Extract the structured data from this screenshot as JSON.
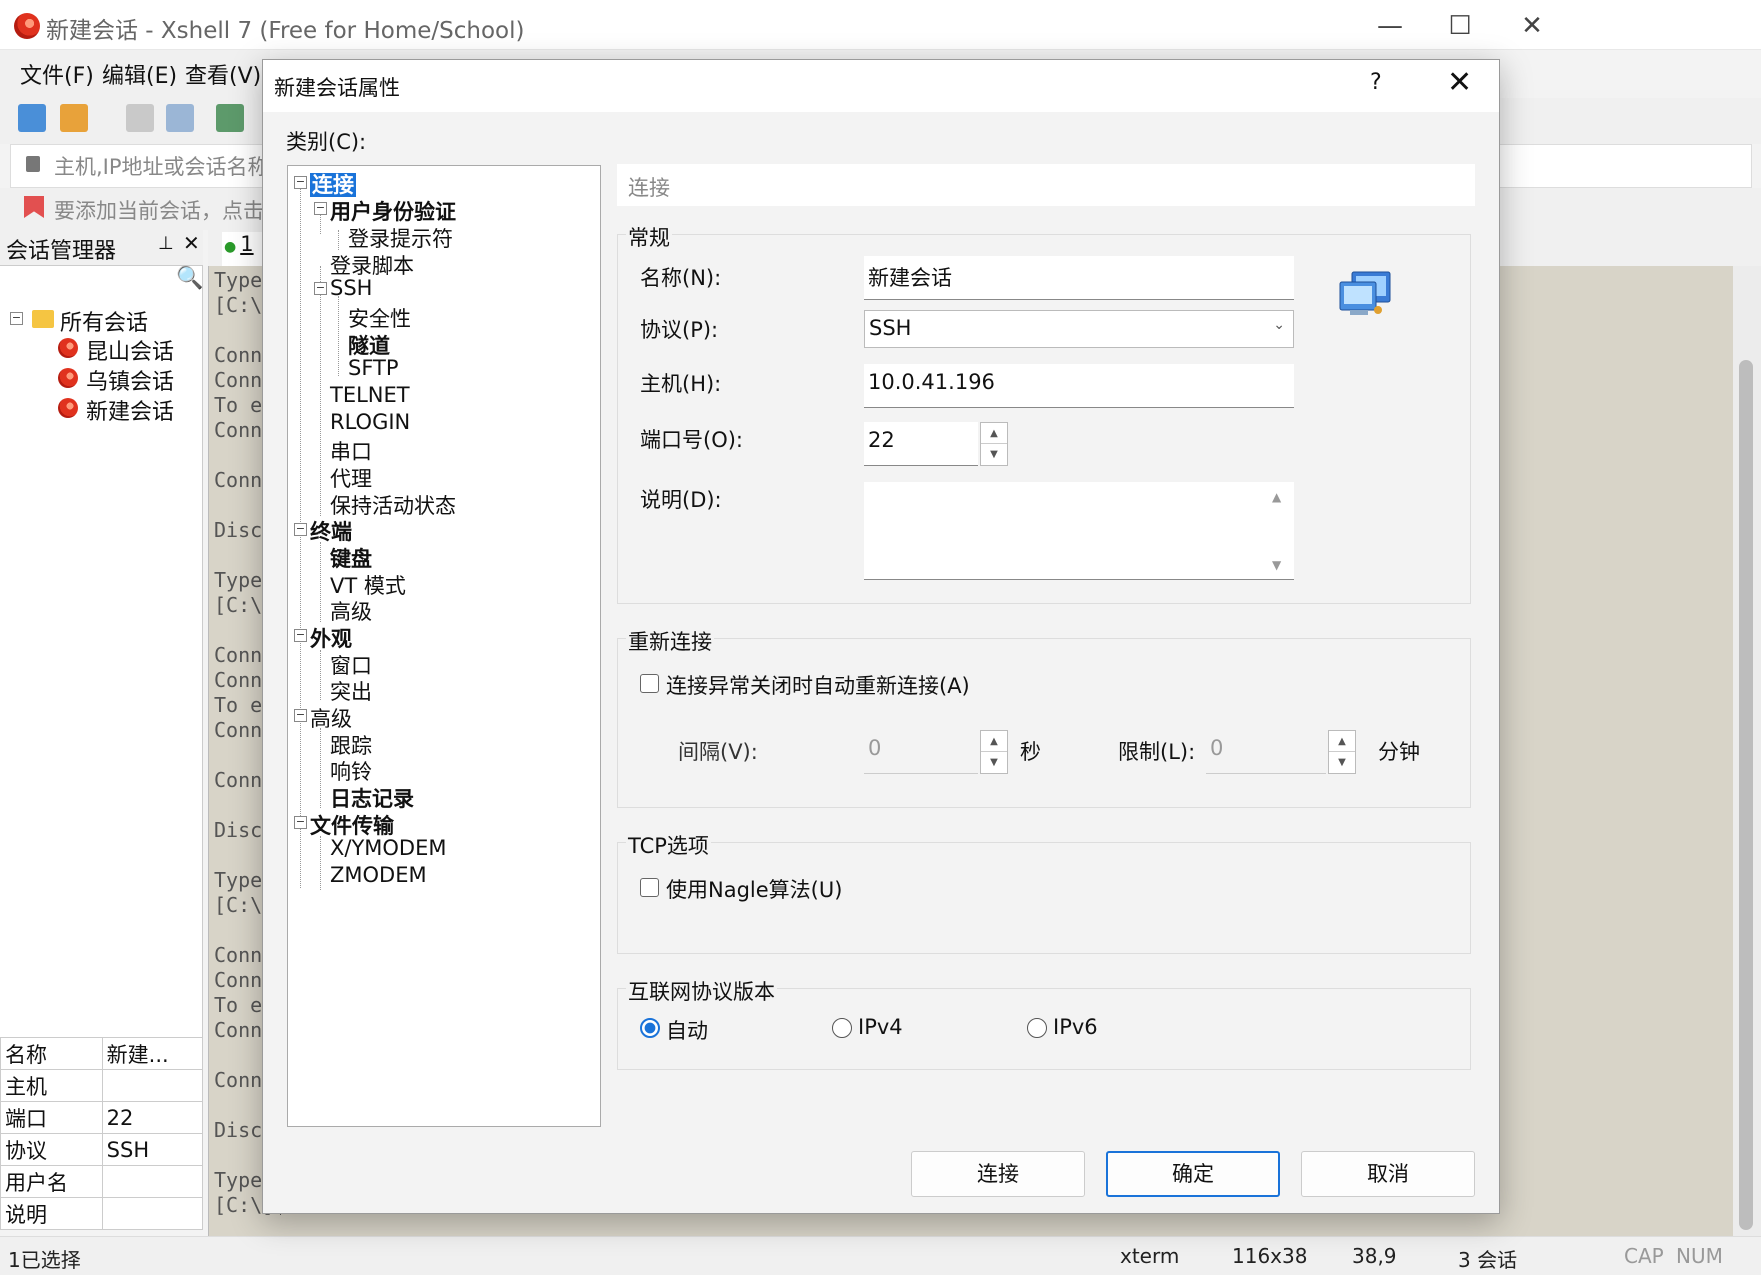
{
  "window": {
    "title": "新建会话 - Xshell 7 (Free for Home/School)",
    "minimize": "—",
    "maximize": "☐",
    "close": "✕"
  },
  "menu": [
    "文件(F)",
    "编辑(E)",
    "查看(V)"
  ],
  "address": {
    "placeholder": "主机,IP地址或会话名称"
  },
  "hint": {
    "text": "要添加当前会话，点击"
  },
  "session_manager": {
    "title": "会话管理器",
    "pin": "⊥",
    "close": "✕",
    "search_icon": "🔍",
    "tree": {
      "root": "所有会话",
      "items": [
        "昆山会话",
        "乌镇会话",
        "新建会话"
      ]
    },
    "props": [
      {
        "key": "名称",
        "value": "新建..."
      },
      {
        "key": "主机",
        "value": ""
      },
      {
        "key": "端口",
        "value": "22"
      },
      {
        "key": "协议",
        "value": "SSH"
      },
      {
        "key": "用户名",
        "value": ""
      },
      {
        "key": "说明",
        "value": ""
      }
    ]
  },
  "terminal": {
    "tab_label": "1",
    "lines": "Type\n[C:\\\n\nConn\nConn\nTo e\nConn\n\nConn\n\nDisc\n\nType\n[C:\\\n\nConn\nConn\nTo e\nConn\n\nConn\n\nDisc\n\nType\n[C:\\\n\nConn\nConn\nTo e\nConn\n\nConn\n\nDisc\n\nType\n[C:\\]$"
  },
  "status": {
    "selection": "1已选择",
    "term": "xterm",
    "size": "116x38",
    "cursor": "38,9",
    "sessions": "3 会话",
    "cap": "CAP",
    "num": "NUM"
  },
  "dialog": {
    "title": "新建会话属性",
    "help": "?",
    "close": "✕",
    "category_label": "类别(C):",
    "categories": {
      "connection": "连接",
      "auth": "用户身份验证",
      "login_prompt": "登录提示符",
      "login_script": "登录脚本",
      "ssh": "SSH",
      "security": "安全性",
      "tunnel": "隧道",
      "sftp": "SFTP",
      "telnet": "TELNET",
      "rlogin": "RLOGIN",
      "serial": "串口",
      "proxy": "代理",
      "keepalive": "保持活动状态",
      "terminal": "终端",
      "keyboard": "键盘",
      "vt_mode": "VT 模式",
      "term_advanced": "高级",
      "appearance": "外观",
      "window": "窗口",
      "highlight": "突出",
      "advanced": "高级",
      "trace": "跟踪",
      "bell": "响铃",
      "logging": "日志记录",
      "file_transfer": "文件传输",
      "xymodem": "X/YMODEM",
      "zmodem": "ZMODEM"
    },
    "panel_title": "连接",
    "general": {
      "title": "常规",
      "name_label": "名称(N):",
      "name_value": "新建会话",
      "protocol_label": "协议(P):",
      "protocol_value": "SSH",
      "host_label": "主机(H):",
      "host_value": "10.0.41.196",
      "port_label": "端口号(O):",
      "port_value": "22",
      "desc_label": "说明(D):",
      "desc_value": ""
    },
    "reconnect": {
      "title": "重新连接",
      "auto_label": "连接异常关闭时自动重新连接(A)",
      "auto_checked": false,
      "interval_label": "间隔(V):",
      "interval_value": "0",
      "interval_unit": "秒",
      "limit_label": "限制(L):",
      "limit_value": "0",
      "limit_unit": "分钟"
    },
    "tcp": {
      "title": "TCP选项",
      "nagle_label": "使用Nagle算法(U)",
      "nagle_checked": false
    },
    "ip_version": {
      "title": "互联网协议版本",
      "options": [
        "自动",
        "IPv4",
        "IPv6"
      ],
      "selected": "自动"
    },
    "buttons": {
      "connect": "连接",
      "ok": "确定",
      "cancel": "取消"
    }
  },
  "colors": {
    "accent": "#1a73d9",
    "terminal_bg": "#d8d4c8"
  }
}
